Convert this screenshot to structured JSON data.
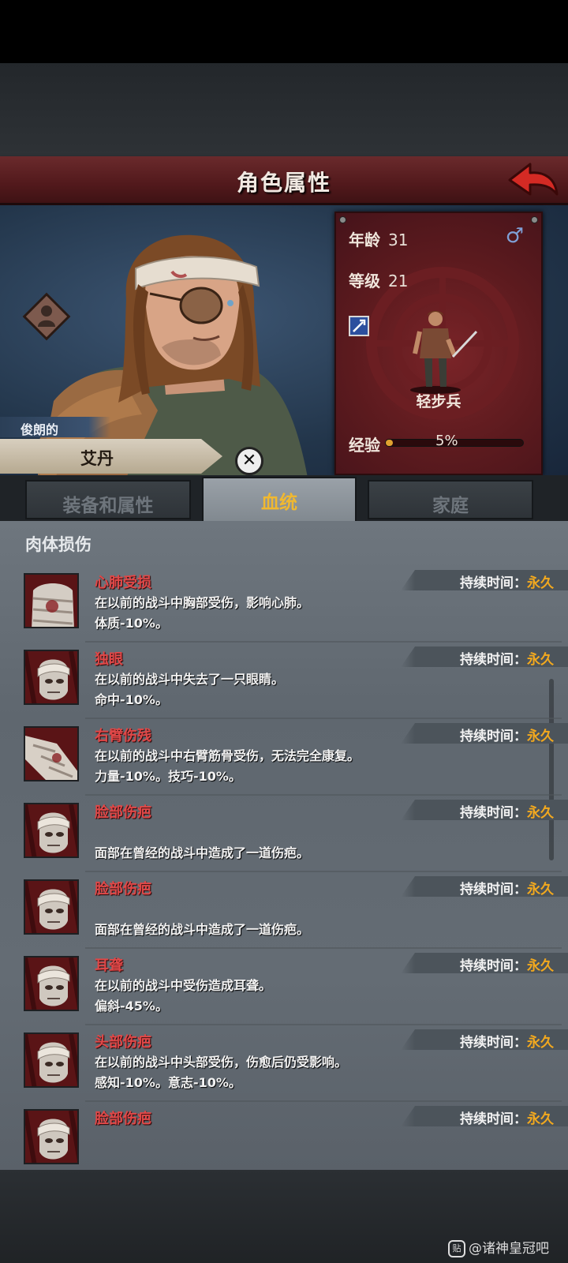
{
  "header": {
    "title": "角色属性"
  },
  "character": {
    "trait": "俊朗的",
    "name": "艾丹"
  },
  "stats": {
    "age_label": "年龄",
    "age_value": "31",
    "level_label": "等级",
    "level_value": "21",
    "gender": "♂",
    "class_name": "轻步兵",
    "exp_label": "经验",
    "exp_percent_text": "5%",
    "exp_fraction": 0.05
  },
  "tabs": [
    {
      "label": "装备和属性",
      "active": false
    },
    {
      "label": "血统",
      "active": true
    },
    {
      "label": "家庭",
      "active": false
    }
  ],
  "section": {
    "title": "肉体损伤"
  },
  "duration_label": "持续时间：",
  "injuries": [
    {
      "name": "心肺受损",
      "line1": "在以前的战斗中胸部受伤，影响心肺。",
      "line2": "体质-10%。",
      "duration": "永久",
      "icon": "torso-wound-icon"
    },
    {
      "name": "独眼",
      "line1": "在以前的战斗中失去了一只眼睛。",
      "line2": "命中-10%。",
      "duration": "永久",
      "icon": "bandaged-head-icon"
    },
    {
      "name": "右臂伤残",
      "line1": "在以前的战斗中右臂筋骨受伤，无法完全康复。",
      "line2": "力量-10%。技巧-10%。",
      "duration": "永久",
      "icon": "bandaged-arm-icon"
    },
    {
      "name": "脸部伤疤",
      "line1": "",
      "line2": "面部在曾经的战斗中造成了一道伤疤。",
      "duration": "永久",
      "icon": "bandaged-head-icon"
    },
    {
      "name": "脸部伤疤",
      "line1": "",
      "line2": "面部在曾经的战斗中造成了一道伤疤。",
      "duration": "永久",
      "icon": "bandaged-head-icon"
    },
    {
      "name": "耳聋",
      "line1": "在以前的战斗中受伤造成耳聋。",
      "line2": "偏斜-45%。",
      "duration": "永久",
      "icon": "bandaged-head-icon"
    },
    {
      "name": "头部伤疤",
      "line1": "在以前的战斗中头部受伤，伤愈后仍受影响。",
      "line2": "感知-10%。意志-10%。",
      "duration": "永久",
      "icon": "bandaged-head-icon"
    },
    {
      "name": "脸部伤疤",
      "line1": "",
      "line2": "",
      "duration": "永久",
      "icon": "bandaged-head-icon"
    }
  ],
  "watermark": {
    "badge": "贴",
    "text": "@诸神皇冠吧"
  }
}
